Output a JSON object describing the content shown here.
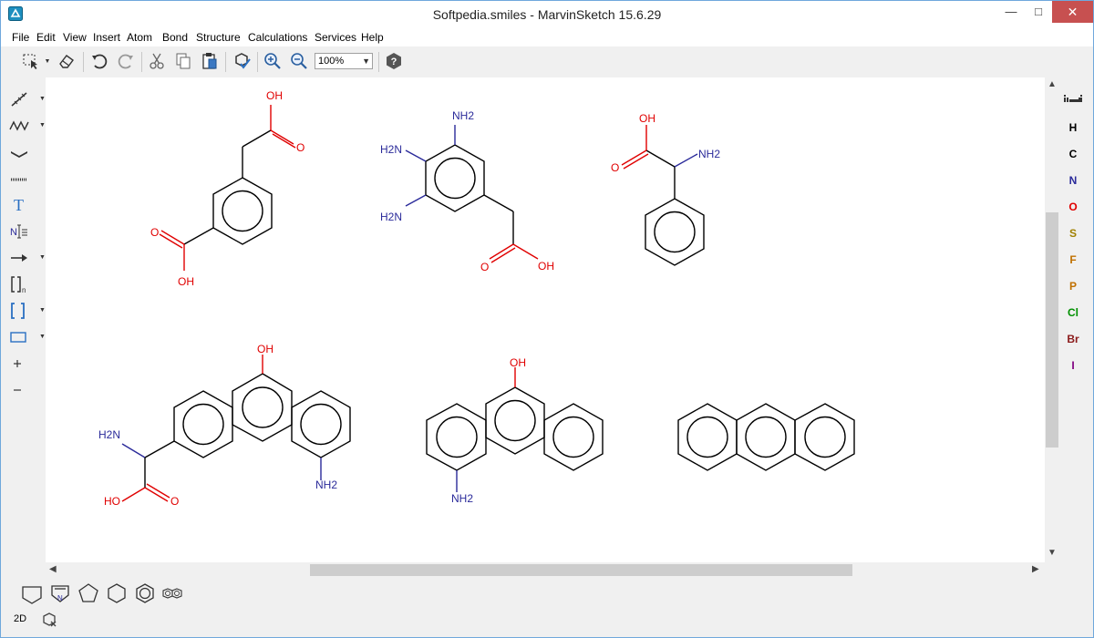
{
  "window": {
    "title": "Softpedia.smiles - MarvinSketch 15.6.29",
    "controls": {
      "minimize": "—",
      "maximize": "□",
      "close": "✕"
    }
  },
  "menu": [
    "File",
    "Edit",
    "View",
    "Insert",
    "Atom",
    "Bond",
    "Structure",
    "Calculations",
    "Services",
    "Help"
  ],
  "toolbar": {
    "zoom": "100%"
  },
  "elements": [
    "H",
    "C",
    "N",
    "O",
    "S",
    "F",
    "P",
    "Cl",
    "Br",
    "I"
  ],
  "element_colors": {
    "H": "#000000",
    "C": "#000000",
    "N": "#2a2a9a",
    "O": "#e00000",
    "S": "#a08000",
    "F": "#c07000",
    "P": "#c07000",
    "Cl": "#009000",
    "Br": "#8b1a1a",
    "I": "#800080"
  },
  "left_tools": {
    "text_tool": "T"
  },
  "status": {
    "mode": "2D"
  },
  "molecules": {
    "m1": {
      "oh_top": "OH",
      "o_top": "O",
      "o_bottom": "O",
      "oh_bottom": "OH"
    },
    "m2": {
      "nh2_top": "NH2",
      "h2n_upper": "H2N",
      "h2n_lower": "H2N",
      "o": "O",
      "oh": "OH"
    },
    "m3": {
      "oh": "OH",
      "o": "O",
      "nh2": "NH2"
    },
    "m4": {
      "oh": "OH",
      "h2n": "H2N",
      "ho": "HO",
      "o": "O",
      "nh2": "NH2"
    },
    "m5": {
      "oh": "OH",
      "nh2": "NH2"
    }
  },
  "colors": {
    "oxygen": "#e00000",
    "nitrogen": "#2a2a9a",
    "bond": "#000000"
  }
}
